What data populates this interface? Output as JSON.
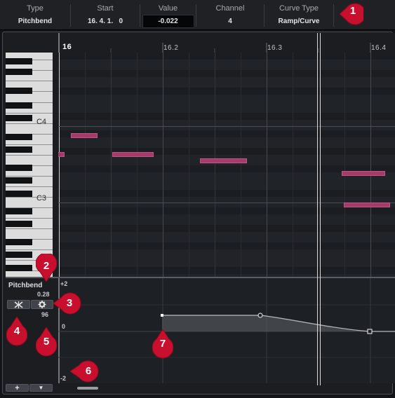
{
  "info_line": {
    "columns": [
      {
        "label": "Type",
        "value": "Pitchbend"
      },
      {
        "label": "Start",
        "value": "16. 4. 1.   0"
      },
      {
        "label": "Value",
        "value": "-0.022"
      },
      {
        "label": "Channel",
        "value": "4"
      },
      {
        "label": "Curve Type",
        "value": "Ramp/Curve"
      }
    ]
  },
  "ruler": {
    "bar_label": "16",
    "labels": [
      "16.2",
      "16.3",
      "16.4"
    ]
  },
  "keyboard": {
    "labels": [
      "C4",
      "C3"
    ]
  },
  "controller_lane": {
    "name": "Pitchbend",
    "current_value": "0.28",
    "secondary_value": "96",
    "scale_top": "+2",
    "scale_mid": "0",
    "scale_bottom": "-2",
    "add_button": "+",
    "menu_button": "▼"
  },
  "callouts": [
    "1",
    "2",
    "3",
    "4",
    "5",
    "6",
    "7"
  ],
  "colors": {
    "note_fill": "#a33c68",
    "callout": "#c8102e",
    "background": "#121417"
  }
}
